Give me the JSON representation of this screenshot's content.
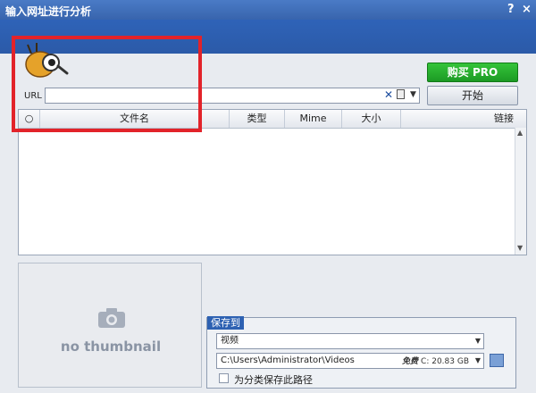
{
  "window": {
    "title": "输入网址进行分析",
    "help": "?",
    "close": "×"
  },
  "buttons": {
    "buy": "购买 PRO",
    "start": "开始"
  },
  "url": {
    "label": "URL",
    "value": ""
  },
  "table": {
    "columns": [
      "○",
      "文件名",
      "类型",
      "Mime",
      "大小",
      "链接"
    ],
    "rows": []
  },
  "thumbnail": {
    "text": "no thumbnail"
  },
  "save": {
    "label": "保存到",
    "format": "视频",
    "path": "C:\\Users\\Administrator\\Videos",
    "free_tag": "免费",
    "free_space": "C: 20.83 GB",
    "checkbox_label": "为分类保存此路径"
  },
  "colors": {
    "title_bar": "#3864ad",
    "buy_button": "#1c9a24",
    "highlight": "#e2232a"
  }
}
